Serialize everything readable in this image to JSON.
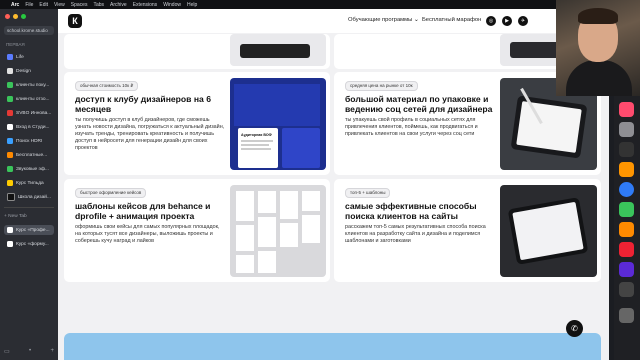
{
  "menubar": {
    "app": "Arc",
    "items": [
      "File",
      "Edit",
      "View",
      "Spaces",
      "Tabs",
      "Archive",
      "Extensions",
      "Window",
      "Help"
    ]
  },
  "sidebar": {
    "url": "school.krome.studio",
    "section_pinned": "ПЕРВАЯ",
    "items": [
      {
        "label": "Life",
        "color": "#5b7cff"
      },
      {
        "label": "Design",
        "color": "#e0e0e0"
      },
      {
        "label": "клиенты поку...",
        "color": "#3ac45b"
      },
      {
        "label": "клиенты отзо...",
        "color": "#3ac45b"
      },
      {
        "label": "SVBO Иннова...",
        "color": "#e53935"
      },
      {
        "label": "Вход в Студи...",
        "color": "#ffffff"
      },
      {
        "label": "Поиск HDRI",
        "color": "#3aa0ff"
      },
      {
        "label": "Бесплатные...",
        "color": "#ff8a00"
      },
      {
        "label": "Звуковые эф...",
        "color": "#3ac45b"
      },
      {
        "label": "Курс Тильда",
        "color": "#ffcc00"
      },
      {
        "label": "Школа дизай...",
        "color": "#111111"
      }
    ],
    "new_tab": "+ New Tab",
    "tabs": [
      {
        "label": "Курс «Профе...",
        "color": "#ffffff"
      },
      {
        "label": "Курс «форму...",
        "color": "#ffffff"
      }
    ]
  },
  "nav": {
    "logo": "К",
    "courses": "Обучающие программы ⌄",
    "marathon": "Бесплатный марафон",
    "social": [
      "◎",
      "▶",
      "✈"
    ]
  },
  "cards": [
    {
      "pill": "обычная стоимость 10к ₽",
      "title": "доступ к клубу дизайнеров на 6 месяцев",
      "desc": "ты получишь доступ в клуб дизайнеров, где сможешь узнать новости дизайна, погружаться к актуальный дизайн, изучать тренды, тренировать креативность и получишь доступ в нейросети для генерации дизайн для своих проектов",
      "thumb_caption": "Аудиторная ВОФ"
    },
    {
      "pill": "средняя цена на рынке от 10к",
      "title": "большой материал по упаковке и ведению соц сетей для дизайнера",
      "desc": "ты упакуешь свой профиль в социальных сетях для привлечения клиентов, поймешь, как продвигаться и привлекать клиентов на свои услуги через соц сети"
    },
    {
      "pill": "быстрое оформление кейсов",
      "title": "шаблоны кейсов для behance и dprofile + анимация проекта",
      "desc": "оформишь свои кейсы для самых популярных площадок, на которых тусят все дизайнеры, выложишь проекты и соберешь кучу наград и лайков"
    },
    {
      "pill": "топ-5 + шаблоны",
      "title": "самые эффективные способы поиска клиентов на сайты",
      "desc": "расскажем топ-5 самых результативных способа поиска клиентов на разработку сайта и дизайна и поделимся шаблонами и заготовками"
    }
  ],
  "fab_icon": "phone-icon"
}
